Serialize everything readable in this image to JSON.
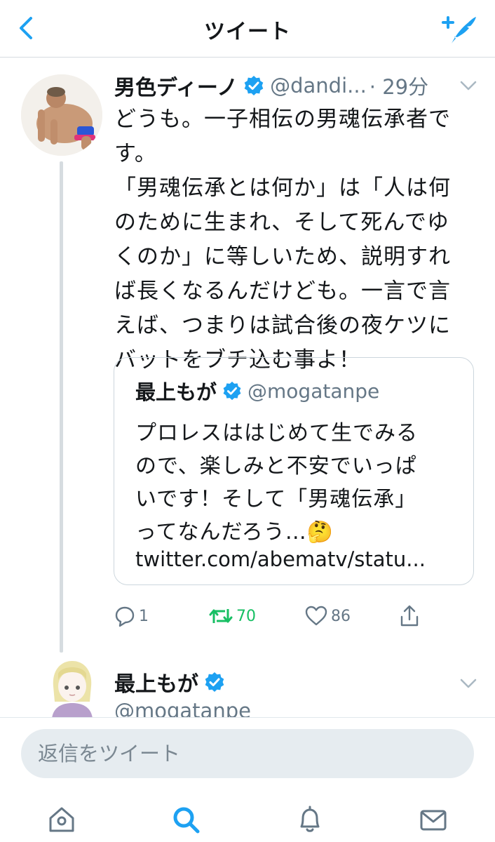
{
  "header": {
    "title": "ツイート",
    "back_icon": "chevron-left-icon",
    "compose_icon": "compose-tweet-icon",
    "accent_color": "#1da1f2"
  },
  "main_tweet": {
    "display_name": "男色ディーノ",
    "verified": true,
    "handle": "@dandi...",
    "time": "· 29分",
    "text_lines": [
      "どうも。一子相伝の男魂伝承者で",
      "す。",
      "「男魂伝承とは何か」は「人は何",
      "のために生まれ、そして死んでゆ",
      "くのか」に等しいため、説明すれ",
      "ば長くなるんだけども。一言で言",
      "えば、つまりは試合後の夜ケツに",
      "バットをブチ込む事よ！"
    ],
    "quote": {
      "display_name": "最上もが",
      "verified": true,
      "handle": "@mogatanpe",
      "text_lines": [
        "プロレスははじめて生でみる",
        "ので、楽しみと不安でいっぱ",
        "いです！そして「男魂伝承」",
        "ってなんだろう…🤔"
      ],
      "link": "twitter.com/abematv/statu..."
    },
    "actions": {
      "reply_count": "1",
      "retweet_count": "70",
      "like_count": "86",
      "retweet_color": "#17bf63"
    }
  },
  "reply_tweet": {
    "display_name": "最上もが",
    "verified": true,
    "handle": "@mogatanpe"
  },
  "composer": {
    "placeholder": "返信をツイート"
  },
  "tabbar": {
    "items": [
      "home-icon",
      "search-icon",
      "notifications-icon",
      "messages-icon"
    ],
    "active": "search-icon"
  }
}
